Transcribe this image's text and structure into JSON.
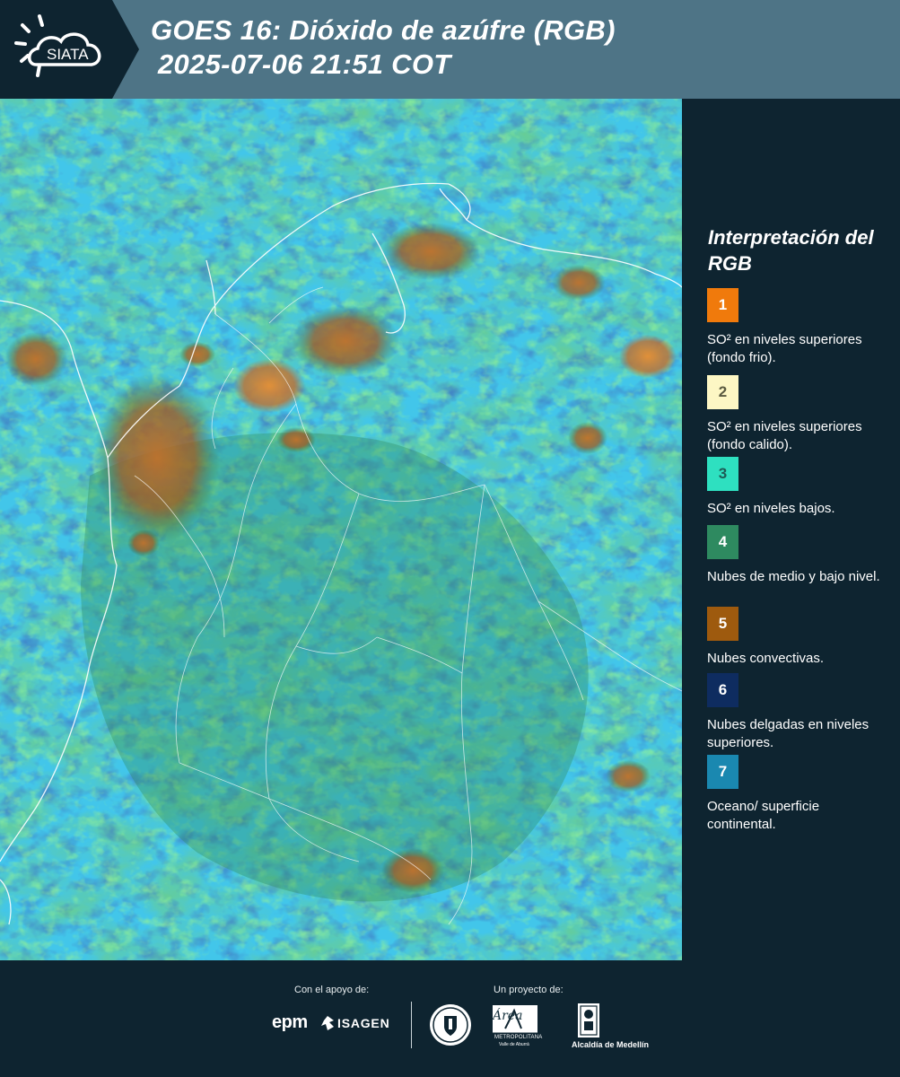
{
  "header": {
    "logo_text": "SIATA",
    "title_line1": "GOES 16: Dióxido de azúfre (RGB)",
    "title_line2": "2025-07-06 21:51 COT"
  },
  "legend": {
    "title": "Interpretación del RGB",
    "items": [
      {
        "number": "1",
        "text": "SO² en niveles superiores (fondo frio).",
        "color": "#f07a0c",
        "number_color": "#ffffff"
      },
      {
        "number": "2",
        "text": "SO² en niveles superiores (fondo calido).",
        "color": "#fdf7c4",
        "number_color": "#5a5a40"
      },
      {
        "number": "3",
        "text": "SO² en niveles bajos.",
        "color": "#2ee0c0",
        "number_color": "#1e5a55"
      },
      {
        "number": "4",
        "text": "Nubes de medio y bajo nivel.",
        "color": "#2e8a60",
        "number_color": "#ffffff"
      },
      {
        "number": "5",
        "text": "Nubes convectivas.",
        "color": "#9e5a0e",
        "number_color": "#ffffff"
      },
      {
        "number": "6",
        "text": "Nubes delgadas en niveles superiores.",
        "color": "#0e2c60",
        "number_color": "#ffffff"
      },
      {
        "number": "7",
        "text": "Oceano/ superficie continental.",
        "color": "#1a88b0",
        "number_color": "#ffffff"
      }
    ]
  },
  "footer": {
    "support_label": "Con el apoyo de:",
    "project_label": "Un proyecto de:",
    "epm_text": "epm",
    "isagen_text": "ISAGEN",
    "area_text": "Área",
    "area_sub1": "METROPOLITANA",
    "area_sub2": "Valle de Aburrá",
    "medellin_text": "Alcaldía de Medellín"
  }
}
